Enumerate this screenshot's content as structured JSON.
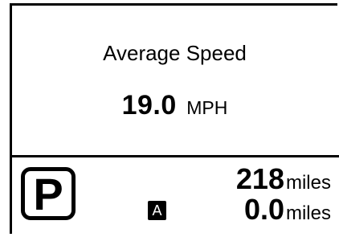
{
  "trip_info": {
    "title": "Average Speed",
    "value": "19.0",
    "unit": "MPH"
  },
  "status_bar": {
    "gear": "P",
    "mode_badge": "A",
    "range": {
      "value": "218",
      "unit": "miles"
    },
    "trip_distance": {
      "value": "0.0",
      "unit": "miles"
    }
  },
  "colors": {
    "background": "#ffffff",
    "foreground": "#000000"
  }
}
